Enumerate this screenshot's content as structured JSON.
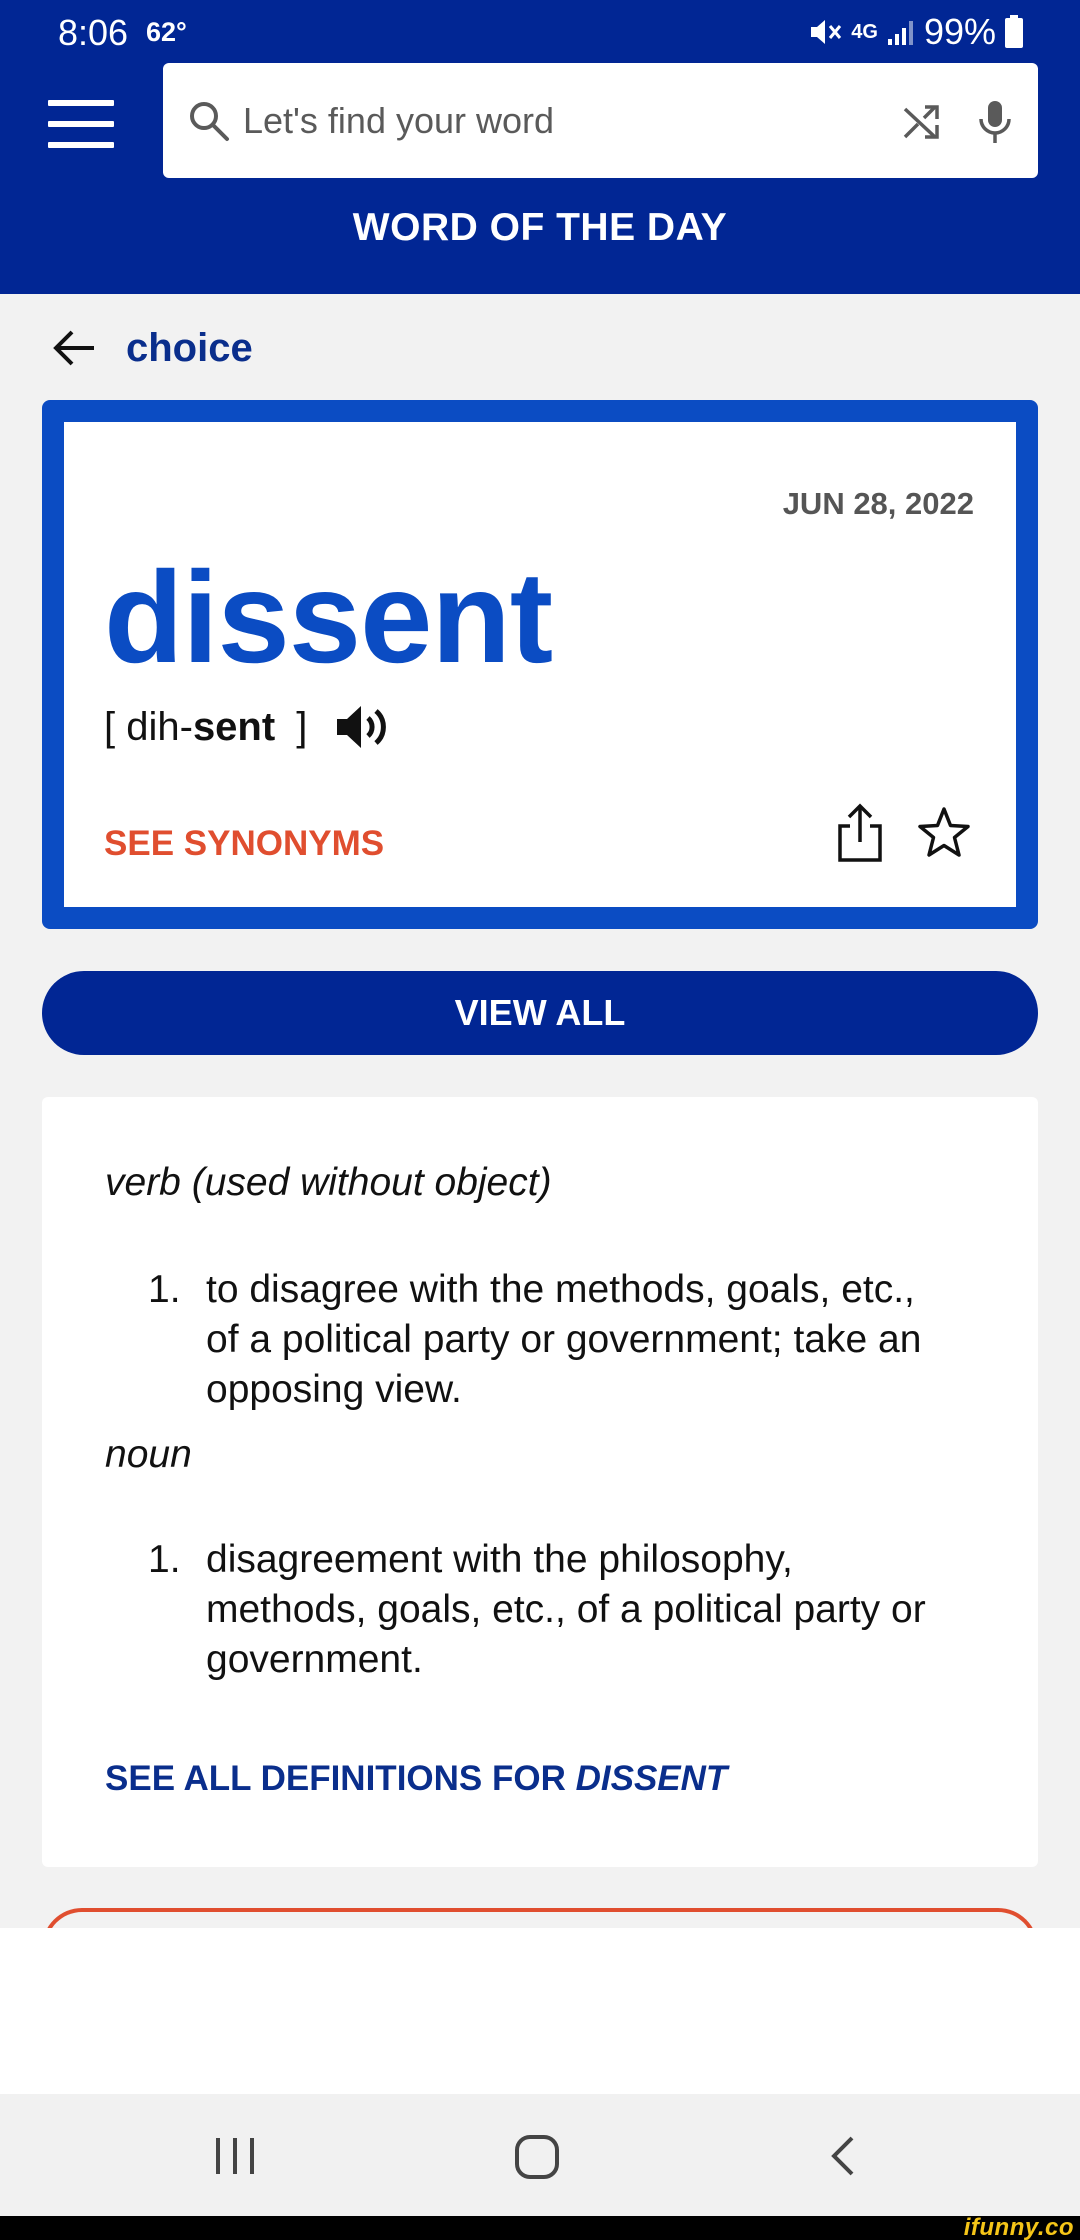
{
  "status_bar": {
    "time": "8:06",
    "temperature": "62°",
    "network": "4G",
    "battery": "99%"
  },
  "search": {
    "placeholder": "Let's find your word"
  },
  "header": {
    "title": "WORD OF THE DAY"
  },
  "back": {
    "word": "choice"
  },
  "word_card": {
    "date": "JUN 28, 2022",
    "word": "dissent",
    "pron_open": "[ dih-",
    "pron_bold": "sent",
    "pron_close": " ]",
    "synonyms_label": "SEE SYNONYMS"
  },
  "view_all_label": "VIEW ALL",
  "definitions": {
    "groups": [
      {
        "part_of_speech": "verb (used without object)",
        "items": [
          {
            "num": "1.",
            "text": "to disagree with the methods, goals, etc., of a political party or government; take an opposing view."
          }
        ]
      },
      {
        "part_of_speech": "noun",
        "items": [
          {
            "num": "1.",
            "text": "disagreement with the philosophy, methods, goals, etc., of a political party or government."
          }
        ]
      }
    ],
    "see_all_prefix": "SEE ALL DEFINITIONS FOR ",
    "see_all_word": "DISSENT"
  },
  "watermark": "ifunny.co",
  "colors": {
    "header_blue": "#012694",
    "card_blue": "#0b4cc3",
    "accent_orange": "#e04e2f",
    "link_blue": "#0a2e8c"
  }
}
